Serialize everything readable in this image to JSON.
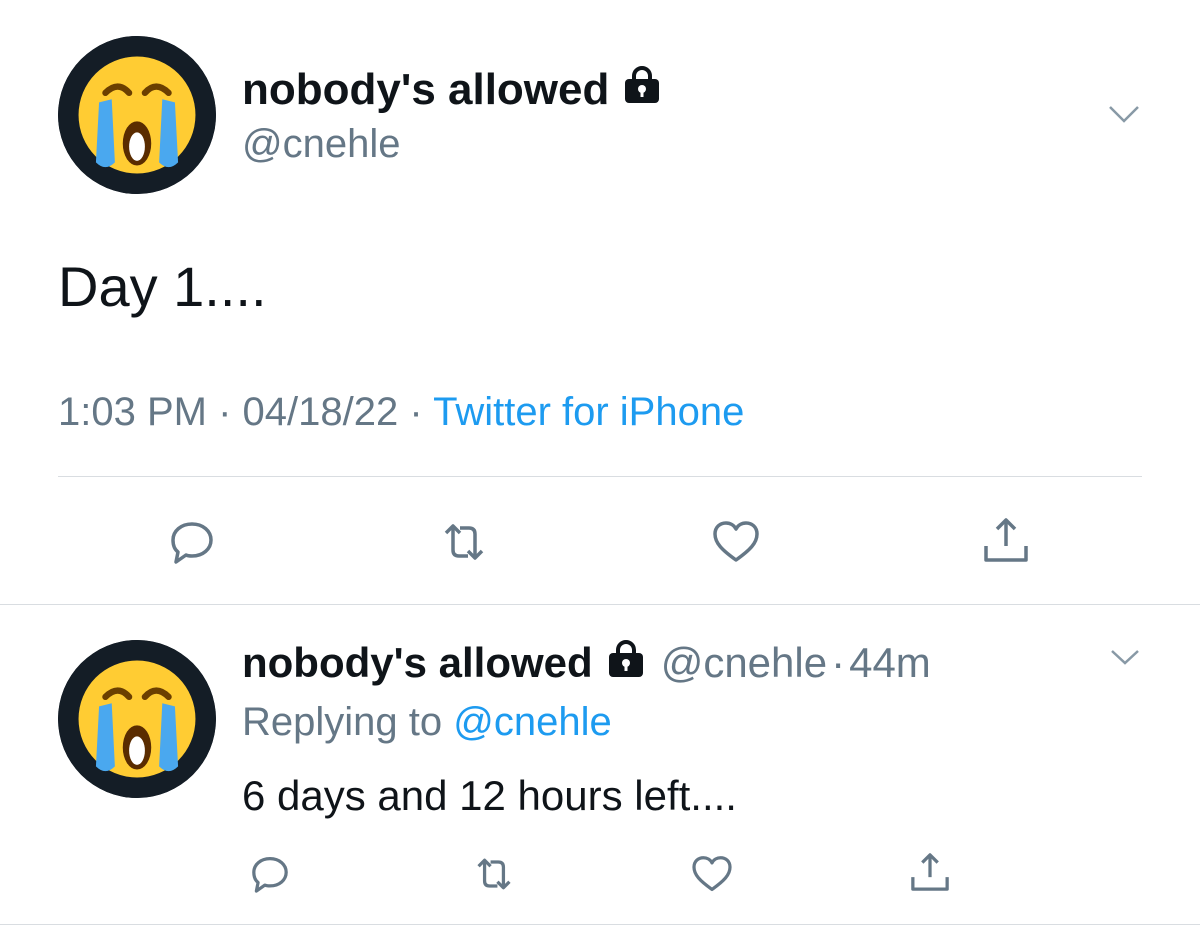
{
  "main_tweet": {
    "display_name": "nobody's allowed",
    "handle": "@cnehle",
    "text": "Day 1....",
    "time": "1:03 PM",
    "sep1": "·",
    "date": "04/18/22",
    "sep2": "·",
    "source": "Twitter for iPhone",
    "avatar_icon": "loudly-crying-face-emoji",
    "lock_icon": "lock-icon",
    "actions": [
      "reply-icon",
      "retweet-icon",
      "like-icon",
      "share-icon"
    ]
  },
  "reply_tweet": {
    "display_name": "nobody's allowed",
    "handle": "@cnehle",
    "sep": "·",
    "age": "44m",
    "replying_prefix": "Replying to",
    "replying_to": "@cnehle",
    "text": "6 days and 12 hours left....",
    "avatar_icon": "loudly-crying-face-emoji",
    "lock_icon": "lock-icon",
    "actions": [
      "reply-icon",
      "retweet-icon",
      "like-icon",
      "share-icon"
    ]
  },
  "colors": {
    "text": "#0f1419",
    "muted": "#657786",
    "link": "#1d9bf0",
    "icon": "#657786",
    "avatar_bg": "#141d26",
    "divider": "#d9dde1"
  }
}
